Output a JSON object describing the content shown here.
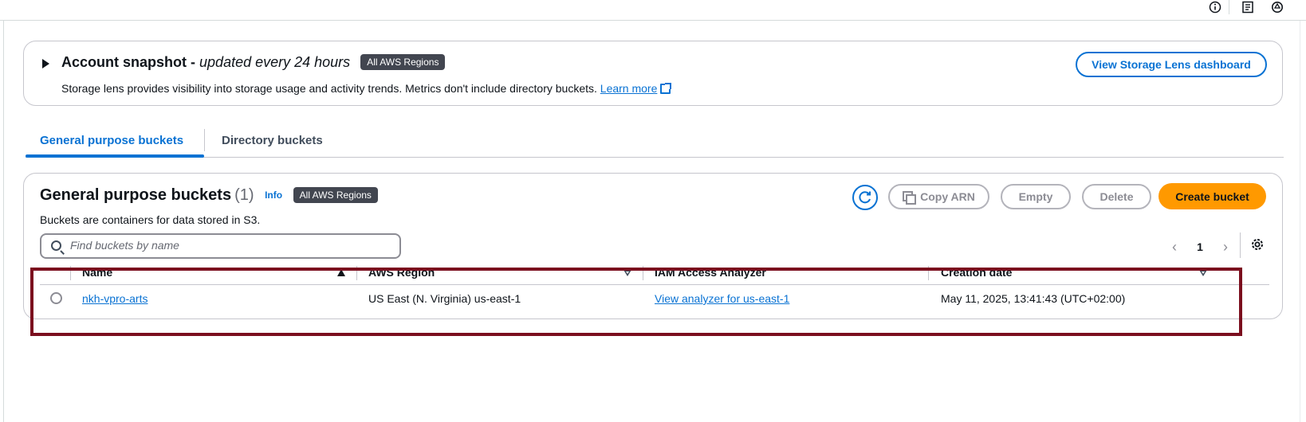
{
  "topbar": {
    "icons": [
      "info-icon",
      "panel-icon",
      "settings-panel-icon"
    ]
  },
  "snapshot": {
    "title_bold": "Account snapshot -",
    "title_italic": "updated every 24 hours",
    "badge": "All AWS Regions",
    "description": "Storage lens provides visibility into storage usage and activity trends. Metrics don't include directory buckets.",
    "learn_more": "Learn more",
    "dashboard_button": "View Storage Lens dashboard"
  },
  "tabs": [
    {
      "label": "General purpose buckets",
      "active": true
    },
    {
      "label": "Directory buckets",
      "active": false
    }
  ],
  "buckets": {
    "title": "General purpose buckets",
    "count": "(1)",
    "info": "Info",
    "badge": "All AWS Regions",
    "description": "Buckets are containers for data stored in S3.",
    "search_placeholder": "Find buckets by name",
    "actions": {
      "copy_arn": "Copy ARN",
      "empty": "Empty",
      "delete": "Delete",
      "create": "Create bucket"
    },
    "pagination": {
      "page": "1"
    },
    "columns": [
      "Name",
      "AWS Region",
      "IAM Access Analyzer",
      "Creation date"
    ],
    "rows": [
      {
        "name": "nkh-vpro-arts",
        "region": "US East (N. Virginia) us-east-1",
        "analyzer": "View analyzer for us-east-1",
        "created": "May 11, 2025, 13:41:43 (UTC+02:00)"
      }
    ]
  },
  "colors": {
    "accent": "#0972d3",
    "primary_button": "#ff9900",
    "badge_bg": "#424650",
    "highlight": "#7b0e1e"
  }
}
